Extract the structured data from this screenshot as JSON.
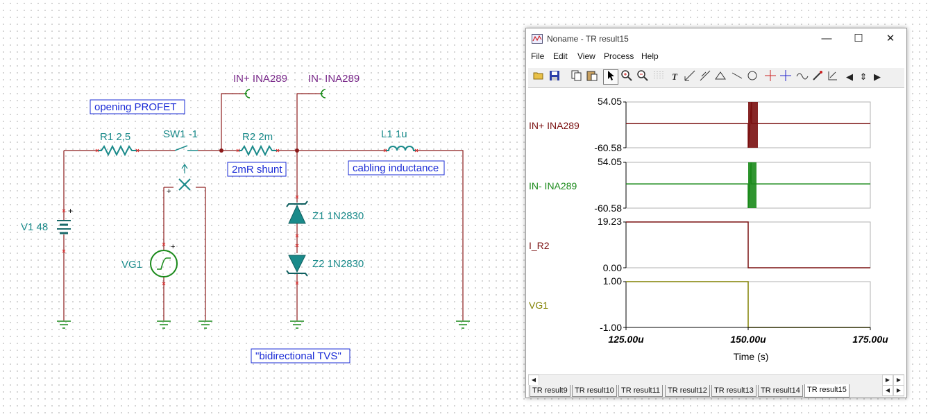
{
  "schematic": {
    "probe_in_plus": "IN+ INA289",
    "probe_in_minus": "IN- INA289",
    "label_profet": "opening PROFET",
    "label_shunt": "2mR shunt",
    "label_cabling": "cabling inductance",
    "label_tvs": "\"bidirectional TVS\"",
    "r1": "R1 2,5",
    "sw1": "SW1 -1",
    "r2": "R2 2m",
    "l1": "L1 1u",
    "v1": "V1 48",
    "vg1": "VG1",
    "z1": "Z1 1N2830",
    "z2": "Z2 1N2830",
    "plus_sign": "+"
  },
  "window": {
    "title": "Noname - TR result15",
    "controls": {
      "minimize": "—",
      "maximize": "☐",
      "close": "✕"
    },
    "menu": [
      "File",
      "Edit",
      "View",
      "Process",
      "Help"
    ]
  },
  "toolbar": {
    "icons": [
      "open-icon",
      "save-icon",
      "copy-icon",
      "paste-icon",
      "pointer-icon",
      "zoom-in-icon",
      "zoom-out-icon",
      "grid-icon",
      "text-icon",
      "axis-x-icon",
      "axis-y-icon",
      "axis-z-icon",
      "line-icon",
      "circle-icon",
      "cursor-a-icon",
      "cursor-b-icon",
      "wave-icon",
      "probe-icon",
      "pen-icon",
      "step-icon",
      "left-icon",
      "updown-icon",
      "right-icon"
    ]
  },
  "chart_data": {
    "type": "line",
    "x_unit": "s",
    "xlabel": "Time (s)",
    "xlim": [
      0.000125,
      0.000175
    ],
    "xticks": [
      "125.00u",
      "150.00u",
      "175.00u"
    ],
    "series": [
      {
        "name": "IN+ INA289",
        "color": "#7a1010",
        "ymax_label": "54.05",
        "ymin_label": "-60.58",
        "ylim": [
          -60.58,
          54.05
        ],
        "x": [
          "125.00u",
          "150.00u",
          "150.00u",
          "150.70u",
          "150.70u",
          "175.00u"
        ],
        "y": [
          0,
          0,
          -60.58,
          54.05,
          0,
          0
        ]
      },
      {
        "name": "IN- INA289",
        "color": "#1a8a1a",
        "ymax_label": "54.05",
        "ymin_label": "-60.58",
        "ylim": [
          -60.58,
          54.05
        ],
        "x": [
          "125.00u",
          "150.00u",
          "150.00u",
          "150.60u",
          "150.60u",
          "175.00u"
        ],
        "y": [
          0,
          0,
          -60.58,
          54.05,
          0,
          0
        ]
      },
      {
        "name": "I_R2",
        "color": "#7a1010",
        "ymax_label": "19.23",
        "ymin_label": "0.00",
        "ylim": [
          0,
          19.23
        ],
        "x": [
          "125.00u",
          "150.00u",
          "150.00u",
          "175.00u"
        ],
        "y": [
          19.23,
          19.23,
          0,
          0
        ]
      },
      {
        "name": "VG1",
        "color": "#808000",
        "ymax_label": "1.00",
        "ymin_label": "-1.00",
        "ylim": [
          -1,
          1
        ],
        "x": [
          "125.00u",
          "150.00u",
          "150.00u",
          "175.00u"
        ],
        "y": [
          1,
          1,
          -1,
          -1
        ]
      }
    ]
  },
  "tabs": [
    "TR result9",
    "TR result10",
    "TR result11",
    "TR result12",
    "TR result13",
    "TR result14",
    "TR result15"
  ],
  "active_tab": "TR result15"
}
